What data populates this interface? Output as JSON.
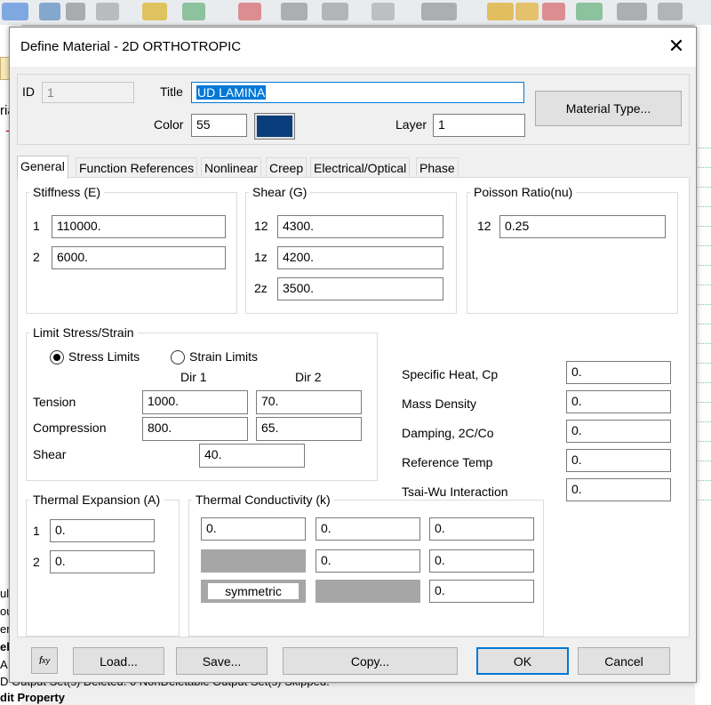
{
  "background": {
    "left_texts": [
      "ria",
      "-"
    ],
    "bottom_lines": [
      "ull",
      "ou",
      "er",
      "el",
      "A",
      "D Output Set(s) Deleted. 0 NonDeletable Output Set(s) Skipped.",
      "dit Property"
    ]
  },
  "dialog": {
    "title": "Define Material - 2D ORTHOTROPIC",
    "close_icon": "close-icon"
  },
  "header": {
    "id_label": "ID",
    "id_value": "1",
    "title_label": "Title",
    "title_value": "UD LAMINA",
    "color_label": "Color",
    "color_value": "55",
    "swatch_color": "#0a3d7c",
    "layer_label": "Layer",
    "layer_value": "1",
    "material_type_button": "Material Type..."
  },
  "tabs": [
    {
      "label": "General",
      "active": true
    },
    {
      "label": "Function References",
      "active": false
    },
    {
      "label": "Nonlinear",
      "active": false
    },
    {
      "label": "Creep",
      "active": false
    },
    {
      "label": "Electrical/Optical",
      "active": false
    },
    {
      "label": "Phase",
      "active": false
    }
  ],
  "stiffness": {
    "legend": "Stiffness (E)",
    "rows": [
      {
        "label": "1",
        "value": "110000."
      },
      {
        "label": "2",
        "value": "6000."
      }
    ]
  },
  "shear": {
    "legend": "Shear (G)",
    "rows": [
      {
        "label": "12",
        "value": "4300."
      },
      {
        "label": "1z",
        "value": "4200."
      },
      {
        "label": "2z",
        "value": "3500."
      }
    ]
  },
  "poisson": {
    "legend": "Poisson Ratio(nu)",
    "rows": [
      {
        "label": "12",
        "value": "0.25"
      }
    ]
  },
  "limits": {
    "legend": "Limit Stress/Strain",
    "radio_stress": "Stress Limits",
    "radio_strain": "Strain Limits",
    "dir1": "Dir 1",
    "dir2": "Dir 2",
    "tension_label": "Tension",
    "tension_dir1": "1000.",
    "tension_dir2": "70.",
    "compression_label": "Compression",
    "compression_dir1": "800.",
    "compression_dir2": "65.",
    "shear_label": "Shear",
    "shear_value": "40."
  },
  "properties": [
    {
      "label": "Specific Heat, Cp",
      "value": "0."
    },
    {
      "label": "Mass Density",
      "value": "0."
    },
    {
      "label": "Damping, 2C/Co",
      "value": "0."
    },
    {
      "label": "Reference Temp",
      "value": "0."
    },
    {
      "label": "Tsai-Wu Interaction",
      "value": "0."
    }
  ],
  "thermal_expansion": {
    "legend": "Thermal Expansion (A)",
    "rows": [
      {
        "label": "1",
        "value": "0."
      },
      {
        "label": "2",
        "value": "0."
      }
    ]
  },
  "thermal_conductivity": {
    "legend": "Thermal Conductivity (k)",
    "r1": [
      "0.",
      "0.",
      "0."
    ],
    "r2": [
      "0.",
      "0."
    ],
    "r3": [
      "0."
    ],
    "symmetric_label": "symmetric"
  },
  "buttons": {
    "fxy": "f",
    "fxy_sub": "xy",
    "load": "Load...",
    "save": "Save...",
    "copy": "Copy...",
    "ok": "OK",
    "cancel": "Cancel"
  }
}
